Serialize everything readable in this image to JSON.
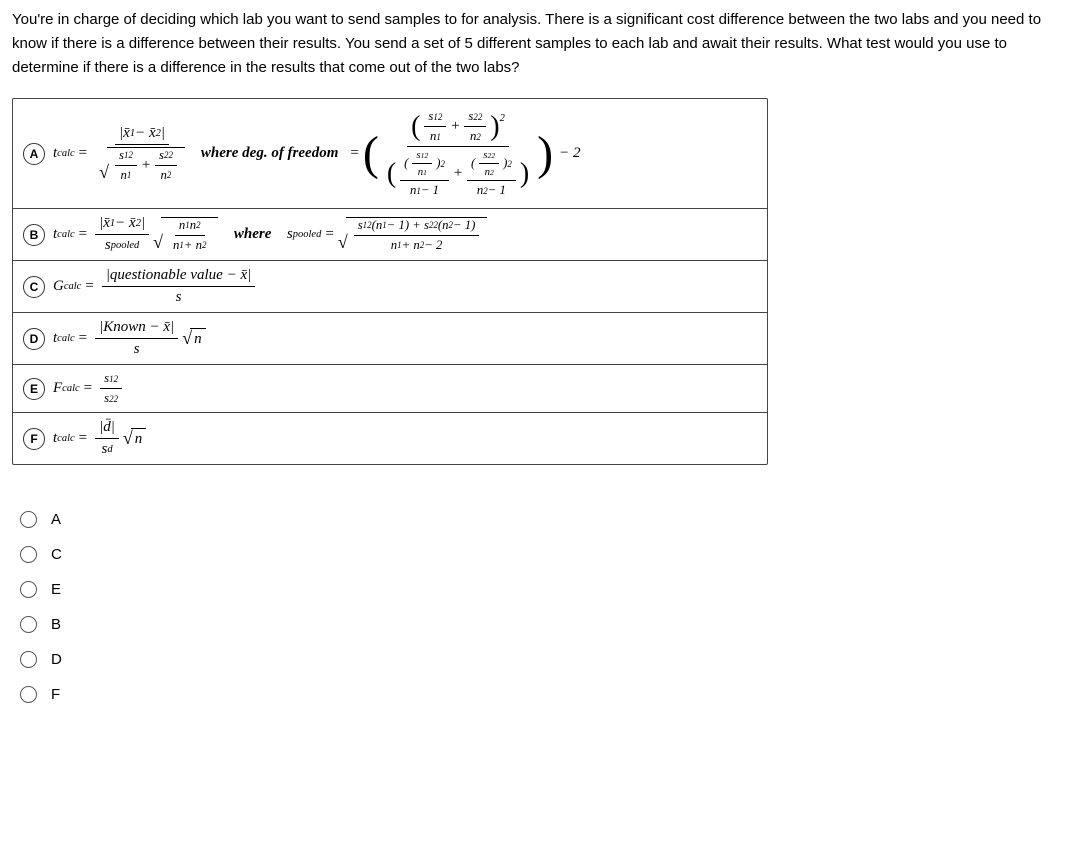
{
  "question": "You're in charge of deciding which lab you want to send samples to for analysis. There is a significant cost difference between the two labs and you need to know if there is a difference between their results. You send a set of 5 different samples to each lab and await their results. What test would you use to determine if there is a difference in the results that come out of the two labs?",
  "choices": {
    "a": {
      "letter": "A",
      "where_text": "where deg. of freedom"
    },
    "b": {
      "letter": "B",
      "where_text": "where"
    },
    "c": {
      "letter": "C",
      "text_num": "|questionable value − x̄|",
      "den": "s"
    },
    "d": {
      "letter": "D",
      "text_num": "|Known − x̄|",
      "den": "s"
    },
    "e": {
      "letter": "E"
    },
    "f": {
      "letter": "F"
    }
  },
  "answers": [
    {
      "label": "A"
    },
    {
      "label": "C"
    },
    {
      "label": "E"
    },
    {
      "label": "B"
    },
    {
      "label": "D"
    },
    {
      "label": "F"
    }
  ]
}
